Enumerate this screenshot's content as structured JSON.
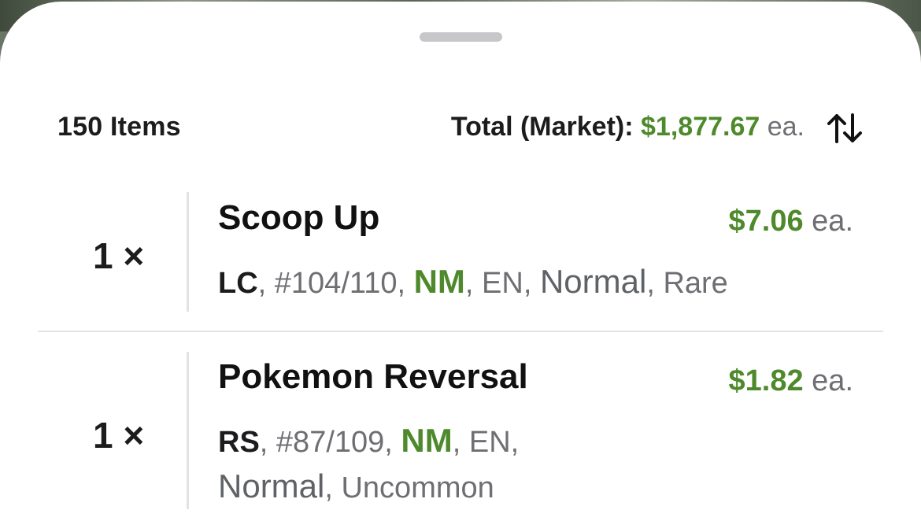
{
  "summary": {
    "item_count": "150 Items",
    "total_label": "Total (Market):",
    "total_value": "$1,877.67",
    "each_suffix": "ea.",
    "sort_icon": "swap-vertical-icon"
  },
  "items": [
    {
      "qty": "1 ×",
      "name": "Scoop Up",
      "price": "$7.06",
      "price_suffix": "ea.",
      "set": "LC",
      "number": "#104/110",
      "condition": "NM",
      "language": "EN",
      "finish": "Normal",
      "rarity": "Rare"
    },
    {
      "qty": "1 ×",
      "name": "Pokemon Reversal",
      "price": "$1.82",
      "price_suffix": "ea.",
      "set": "RS",
      "number": "#87/109",
      "condition": "NM",
      "language": "EN",
      "finish": "Normal",
      "rarity": "Uncommon"
    }
  ],
  "colors": {
    "price_green": "#4e8a2c",
    "secondary_text": "#6e6e73",
    "divider": "#e3e3e5"
  }
}
